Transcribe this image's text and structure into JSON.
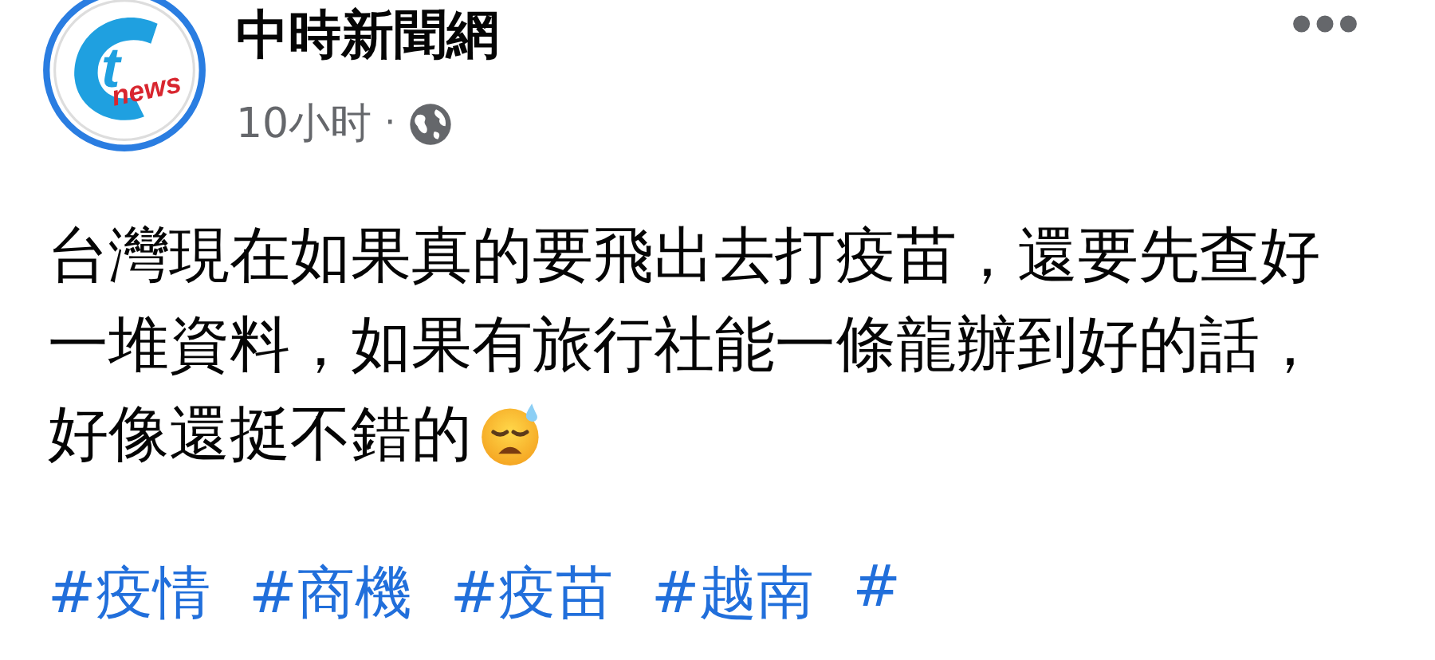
{
  "post": {
    "author": "中時新聞網",
    "logo": {
      "letter": "t",
      "word": "news"
    },
    "time": "10小时",
    "separator": "·",
    "text_lines": [
      "台灣現在如果真的要飛出去打疫苗，還要先查好",
      "一堆資料，如果有旅行社能一條龍辦到好的話，",
      "好像還挺不錯的"
    ],
    "hashtags": [
      "#疫情",
      "#商機",
      "#疫苗",
      "#越南",
      "#"
    ]
  }
}
